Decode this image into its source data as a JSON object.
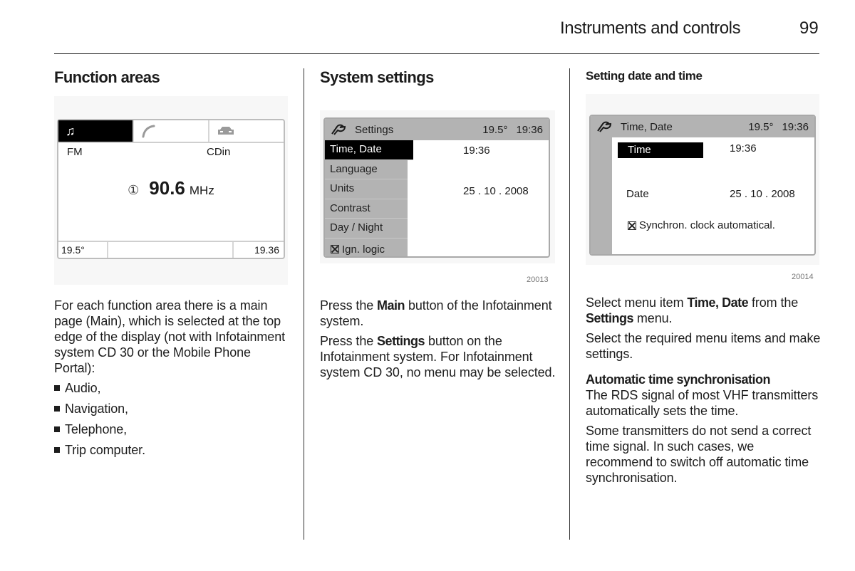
{
  "header": {
    "section": "Instruments and controls",
    "page_number": "99"
  },
  "col1": {
    "title": "Function areas",
    "display": {
      "tabs": [
        {
          "icon": "music-note-icon",
          "glyph": "♫",
          "active": true
        },
        {
          "icon": "phone-icon",
          "glyph": "✆",
          "active": false
        },
        {
          "icon": "car-icon",
          "glyph": "🚗",
          "active": false
        }
      ],
      "source_left": "FM",
      "source_right": "CDin",
      "preset": "①",
      "frequency": "90.6",
      "unit": "MHz",
      "status_left": "19.5°",
      "status_right": "19.36"
    },
    "paragraph": "For each function area there is a main page (Main), which is selected at the top edge of the display (not with Infotainment system CD 30 or the Mobile Phone Portal):",
    "bullets": [
      "Audio,",
      "Navigation,",
      "Telephone,",
      "Trip computer."
    ]
  },
  "col2": {
    "title": "System settings",
    "display": {
      "header_title": "Settings",
      "temperature": "19.5°",
      "clock": "19:36",
      "menu": [
        {
          "label": "Time, Date",
          "selected": true
        },
        {
          "label": "Language",
          "selected": false
        },
        {
          "label": "Units",
          "selected": false
        },
        {
          "label": "Contrast",
          "selected": false
        },
        {
          "label": "Day / Night",
          "selected": false
        },
        {
          "label": "Ign. logic",
          "selected": false,
          "checkbox": true
        }
      ],
      "time_value": "19:36",
      "date_value": "25 . 10 . 2008"
    },
    "figure_number": "20013",
    "p1_pre": "Press the ",
    "p1_bold": "Main",
    "p1_post": " button of the Infotainment system.",
    "p2_pre": "Press the ",
    "p2_bold": "Settings",
    "p2_post": " button on the Infotainment system. For Infotainment system CD 30, no menu may be selected."
  },
  "col3": {
    "title": "Setting date and time",
    "display": {
      "header_title": "Time, Date",
      "temperature": "19.5°",
      "clock": "19:36",
      "time_label": "Time",
      "time_value": "19:36",
      "date_label": "Date",
      "date_value": "25 . 10 . 2008",
      "sync_label": "Synchron. clock automatical."
    },
    "figure_number": "20014",
    "p1_pre": "Select menu item ",
    "p1_bold1": "Time, Date",
    "p1_mid": " from the ",
    "p1_bold2": "Settings",
    "p1_post": " menu.",
    "p2": "Select the required menu items and make settings.",
    "subheading": "Automatic time synchronisation",
    "p3": "The RDS signal of most VHF transmitters automatically sets the time.",
    "p4": "Some transmitters do not send a correct time signal. In such cases, we recommend to switch off automatic time synchronisation."
  }
}
